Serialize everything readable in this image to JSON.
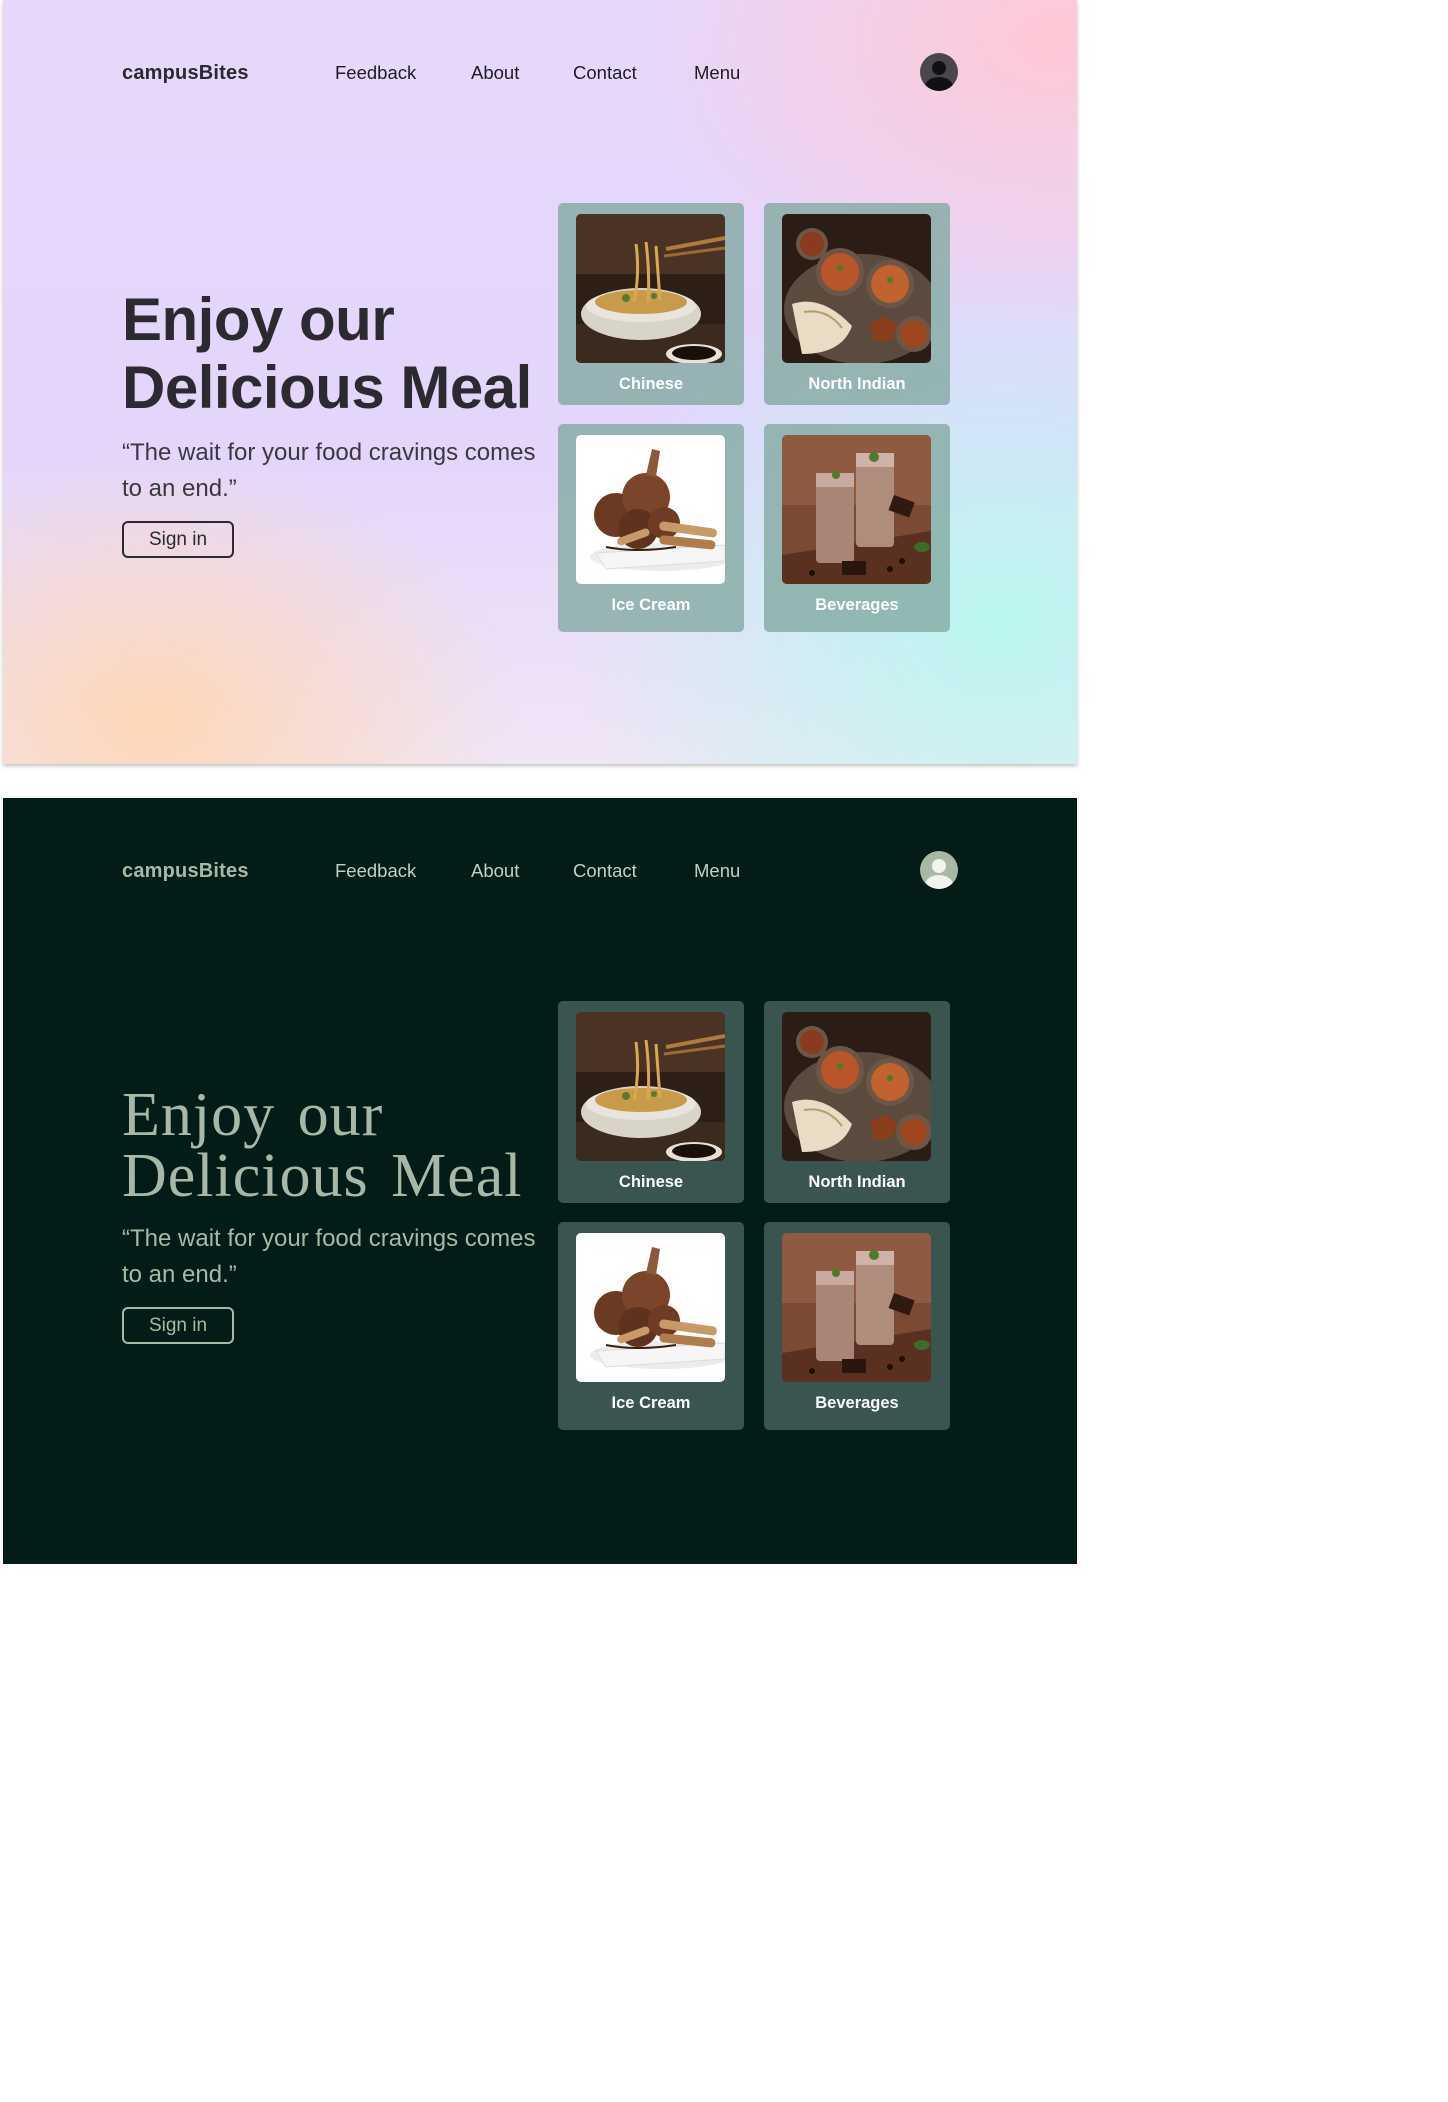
{
  "brand": "campusBites",
  "nav": [
    "Feedback",
    "About",
    "Contact",
    "Menu"
  ],
  "hero": {
    "title_line1": "Enjoy our",
    "title_line2": "Delicious Meal",
    "tagline": "“The wait for your food cravings comes to an end.”",
    "signin_label": "Sign in"
  },
  "categories": [
    {
      "label": "Chinese",
      "image": "noodles-bowl"
    },
    {
      "label": "North Indian",
      "image": "curry-thali"
    },
    {
      "label": "Ice Cream",
      "image": "chocolate-ice-cream"
    },
    {
      "label": "Beverages",
      "image": "chocolate-shakes"
    }
  ],
  "themes": {
    "light": {
      "heading": "#2c2a31",
      "card": "#8fb3ad",
      "bg_accents": [
        "#e6d8fb",
        "#ffc8d6",
        "#baf7f0",
        "#ffd6b4"
      ]
    },
    "dark": {
      "background": "#031c18",
      "text": "#a9b8a6",
      "card": "#3a5450"
    }
  }
}
